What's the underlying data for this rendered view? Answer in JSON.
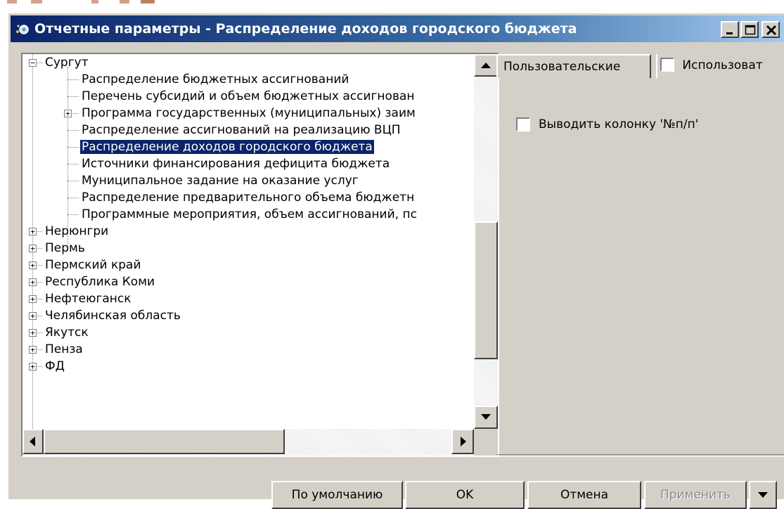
{
  "window": {
    "title": "Отчетные параметры - Распределение доходов городского бюджета",
    "minimize_icon": "minimize-icon",
    "maximize_icon": "maximize-icon",
    "close_icon": "close-icon"
  },
  "tree": {
    "items": [
      {
        "label": "Сургут",
        "level": 0,
        "expander": "⊟",
        "selected": false
      },
      {
        "label": "Распределение бюджетных ассигнований",
        "level": 1,
        "expander": "",
        "selected": false
      },
      {
        "label": "Перечень субсидий  и объем бюджетных ассигнован",
        "level": 1,
        "expander": "",
        "selected": false
      },
      {
        "label": "Программа государственных (муниципальных) заим",
        "level": 1,
        "expander": "+",
        "selected": false
      },
      {
        "label": "Распределение ассигнований на реализацию ВЦП",
        "level": 1,
        "expander": "",
        "selected": false
      },
      {
        "label": "Распределение доходов городского бюджета",
        "level": 1,
        "expander": "",
        "selected": true
      },
      {
        "label": "Источники финансирования дефицита бюджета",
        "level": 1,
        "expander": "",
        "selected": false
      },
      {
        "label": "Муниципальное задание на оказание услуг",
        "level": 1,
        "expander": "",
        "selected": false
      },
      {
        "label": "Распределение предварительного объема бюджетн",
        "level": 1,
        "expander": "",
        "selected": false
      },
      {
        "label": "Программные мероприятия, объем ассигнований, пс",
        "level": 1,
        "expander": "",
        "selected": false
      },
      {
        "label": "Нерюнгри",
        "level": 0,
        "expander": "+",
        "selected": false
      },
      {
        "label": "Пермь",
        "level": 0,
        "expander": "+",
        "selected": false
      },
      {
        "label": "Пермский край",
        "level": 0,
        "expander": "+",
        "selected": false
      },
      {
        "label": "Республика Коми",
        "level": 0,
        "expander": "+",
        "selected": false
      },
      {
        "label": "Нефтеюганск",
        "level": 0,
        "expander": "+",
        "selected": false
      },
      {
        "label": "Челябинская область",
        "level": 0,
        "expander": "+",
        "selected": false
      },
      {
        "label": "Якутск",
        "level": 0,
        "expander": "+",
        "selected": false
      },
      {
        "label": "Пенза",
        "level": 0,
        "expander": "+",
        "selected": false
      },
      {
        "label": "ФД",
        "level": 0,
        "expander": "+",
        "selected": false
      }
    ]
  },
  "tabs": {
    "active_label": "Пользовательские",
    "inactive_label": "Использоват"
  },
  "options": {
    "show_column_label": "Выводить колонку '№п/п'",
    "show_column_checked": false
  },
  "buttons": {
    "default_label": "По умолчанию",
    "ok_label": "OK",
    "cancel_label": "Отмена",
    "apply_label": "Применить"
  }
}
